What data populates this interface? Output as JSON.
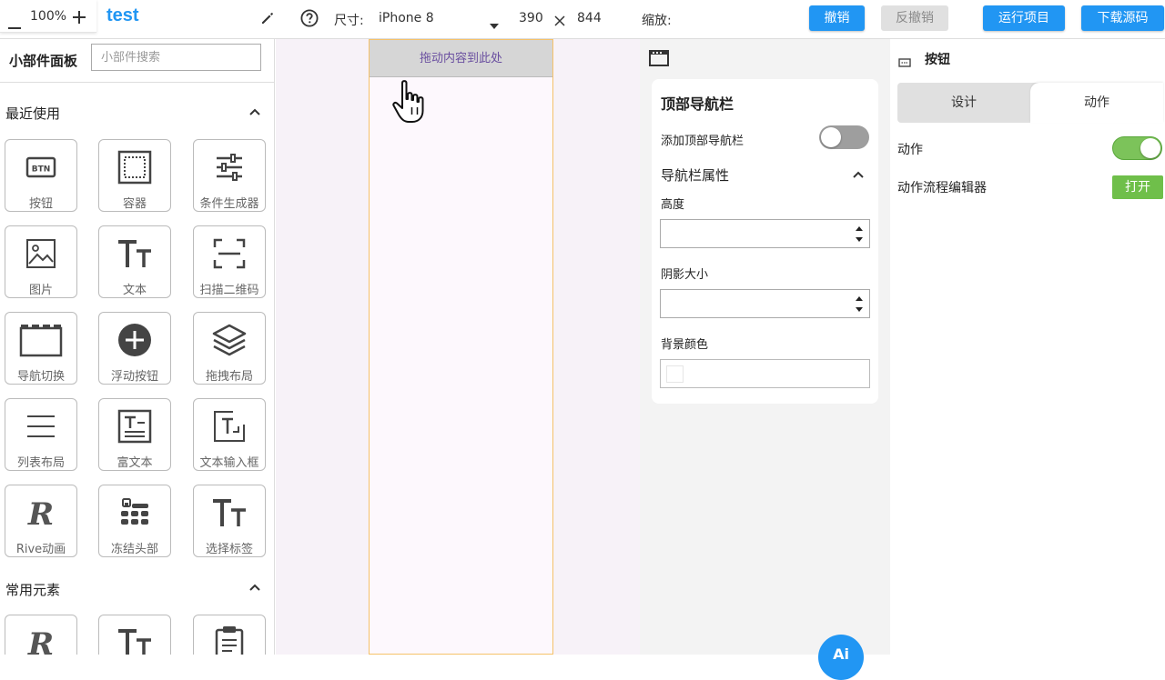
{
  "app": {
    "title": "test"
  },
  "toolbar": {
    "size_label": "尺寸:",
    "device": "iPhone 8",
    "width": "390",
    "height": "844",
    "zoom_label": "缩放:",
    "zoom_value": "100%",
    "undo": "撤销",
    "redo": "反撤销",
    "run": "运行项目",
    "download": "下载源码"
  },
  "widget_panel": {
    "title": "小部件面板",
    "search_placeholder": "小部件搜索",
    "sections": [
      {
        "title": "最近使用",
        "items": [
          {
            "label": "按钮",
            "icon": "btn-icon"
          },
          {
            "label": "容器",
            "icon": "container-icon"
          },
          {
            "label": "条件生成器",
            "icon": "sliders-icon"
          },
          {
            "label": "图片",
            "icon": "image-icon"
          },
          {
            "label": "文本",
            "icon": "text-icon"
          },
          {
            "label": "扫描二维码",
            "icon": "scan-icon"
          },
          {
            "label": "导航切换",
            "icon": "tab-nav-icon"
          },
          {
            "label": "浮动按钮",
            "icon": "fab-icon"
          },
          {
            "label": "拖拽布局",
            "icon": "layers-icon"
          },
          {
            "label": "列表布局",
            "icon": "list-icon"
          },
          {
            "label": "富文本",
            "icon": "richtext-icon"
          },
          {
            "label": "文本输入框",
            "icon": "text-input-icon"
          },
          {
            "label": "Rive动画",
            "icon": "rive-icon"
          },
          {
            "label": "冻结头部",
            "icon": "freeze-header-icon"
          },
          {
            "label": "选择标签",
            "icon": "text-icon"
          }
        ]
      },
      {
        "title": "常用元素",
        "items": [
          {
            "label": "",
            "icon": "rive-icon"
          },
          {
            "label": "",
            "icon": "text-icon"
          },
          {
            "label": "",
            "icon": "clipboard-icon"
          }
        ]
      }
    ]
  },
  "canvas": {
    "drop_hint": "拖动内容到此处"
  },
  "properties": {
    "title": "顶部导航栏",
    "add_navbar_label": "添加顶部导航栏",
    "add_navbar_on": false,
    "navbar_props_title": "导航栏属性",
    "height_label": "高度",
    "height_value": "",
    "shadow_label": "阴影大小",
    "shadow_value": "",
    "bg_color_label": "背景颜色",
    "ai_label": "Ai"
  },
  "inspector": {
    "widget_name": "按钮",
    "tabs": [
      "设计",
      "动作"
    ],
    "active_tab": "动作",
    "action_label": "动作",
    "action_on": true,
    "flow_editor_label": "动作流程编辑器",
    "open_label": "打开"
  },
  "colors": {
    "accent": "#2196f3",
    "toggle_on": "#7cc35a",
    "phone_border": "#f5c26a"
  }
}
